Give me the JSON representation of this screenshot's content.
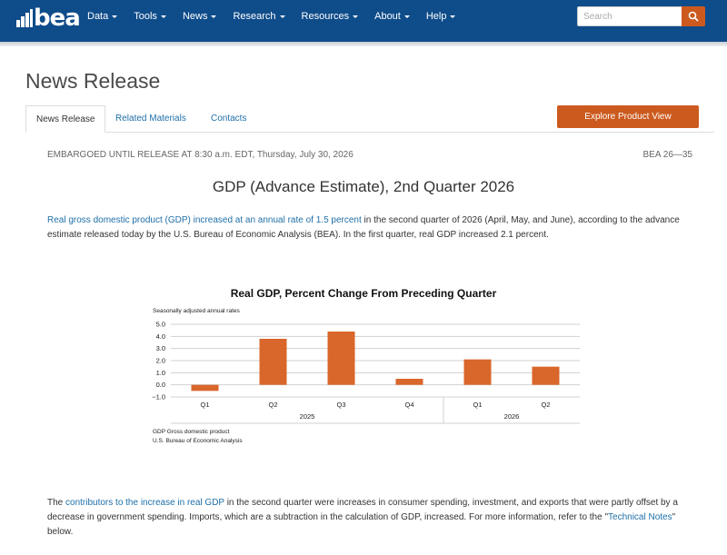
{
  "header": {
    "logo_text": "bea",
    "nav": [
      {
        "label": "Data",
        "dropdown": true
      },
      {
        "label": "Tools",
        "dropdown": true
      },
      {
        "label": "News",
        "dropdown": true
      },
      {
        "label": "Research",
        "dropdown": true
      },
      {
        "label": "Resources",
        "dropdown": true
      },
      {
        "label": "About",
        "dropdown": true
      },
      {
        "label": "Help",
        "dropdown": true
      }
    ],
    "search_placeholder": "Search",
    "search_icon": "search-icon",
    "colors": {
      "bar": "#0f4c8a",
      "accent": "#cc5a1e"
    }
  },
  "page": {
    "title": "News Release",
    "tabs": [
      "News Release",
      "Related Materials",
      "Contacts"
    ],
    "active_tab": "News Release",
    "explore_button": "Explore Product View",
    "embargo": "EMBARGOED UNTIL RELEASE AT 8:30 a.m. EDT, Thursday, July 30, 2026",
    "release_number": "BEA 26—35",
    "headline": "GDP (Advance Estimate), 2nd Quarter 2026"
  },
  "para1": {
    "link1": "Real gross domestic product",
    "link2": "(GDP)",
    "link3": "increased at an annual rate of 1.5 percent",
    "text": " in the second quarter of 2026 (April, May, and June), according to the advance estimate released today by the U.S. Bureau of Economic Analysis (BEA). In the first quarter, real GDP increased 2.1 percent."
  },
  "para2": {
    "lead": "The ",
    "link1": "contributors to the increase in real GDP",
    "text": " in the second quarter were increases in consumer spending, investment, and exports that were partly offset by a decrease in government spending. Imports, which are a subtraction in the calculation of GDP, increased. For more information, refer to the \"",
    "link2": "Technical Notes",
    "tail": "\" below."
  },
  "chart_data": {
    "type": "bar",
    "title": "Real GDP, Percent Change From Preceding Quarter",
    "subtitle": "Seasonally adjusted annual rates",
    "categories": [
      "Q1",
      "Q2",
      "Q3",
      "Q4",
      "Q1",
      "Q2"
    ],
    "groups": [
      {
        "label": "2025",
        "count": 4
      },
      {
        "label": "2026",
        "count": 2
      }
    ],
    "values": [
      -0.5,
      3.8,
      4.4,
      0.5,
      2.1,
      1.5
    ],
    "ylim": [
      -1.0,
      5.0
    ],
    "yticks": [
      5.0,
      4.0,
      3.0,
      2.0,
      1.0,
      0.0,
      -1.0
    ],
    "ytick_labels": [
      "5.0",
      "4.0",
      "3.0",
      "2.0",
      "1.0",
      "0.0",
      "−1.0"
    ],
    "bar_color": "#d9662a",
    "grid": true,
    "footnotes": [
      "GDP Gross domestic product",
      "U.S. Bureau of Economic Analysis"
    ]
  }
}
